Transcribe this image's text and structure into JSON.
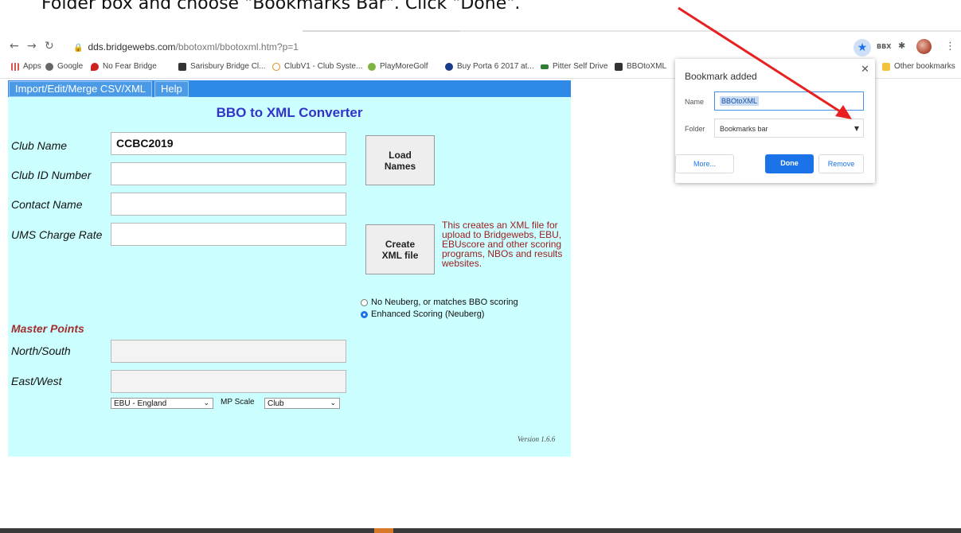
{
  "caption": "Folder box and choose \"Bookmarks Bar\". Click \"Done\".",
  "browser": {
    "url_host": "dds.bridgewebs.com",
    "url_path": "/bbotoxml/bbotoxml.htm?p=1",
    "extension_label": "BBX",
    "bookmarks": [
      {
        "label": "Apps",
        "color": "#d9534f"
      },
      {
        "label": "Google",
        "color": "#555555"
      },
      {
        "label": "No Fear Bridge",
        "color": "#cc2222"
      },
      {
        "label": "Sarisbury Bridge Cl...",
        "color": "#333333"
      },
      {
        "label": "ClubV1 - Club Syste...",
        "color": "#e88a1a"
      },
      {
        "label": "PlayMoreGolf",
        "color": "#7cb342"
      },
      {
        "label": "Buy Porta 6 2017 at...",
        "color": "#1a3a8a"
      },
      {
        "label": "Pitter Self Drive",
        "color": "#2e7d32"
      },
      {
        "label": "BBOtoXML",
        "color": "#333333"
      }
    ],
    "other_bookmarks": "Other bookmarks"
  },
  "app": {
    "menu": [
      "Import/Edit/Merge CSV/XML",
      "Help"
    ],
    "title": "BBO to XML Converter",
    "fields": {
      "club_name": {
        "label": "Club Name",
        "value": "CCBC2019"
      },
      "club_id": {
        "label": "Club ID Number",
        "value": ""
      },
      "contact_name": {
        "label": "Contact Name",
        "value": ""
      },
      "ums_charge": {
        "label": "UMS Charge Rate",
        "value": ""
      }
    },
    "load_names": "Load Names",
    "create_xml": "Create XML file",
    "create_note": "This creates an XML file for upload to Bridgewebs, EBU, EBUscore and other scoring programs, NBOs and results websites.",
    "scoring_options": [
      {
        "label": "No Neuberg, or matches BBO scoring",
        "selected": false
      },
      {
        "label": "Enhanced Scoring (Neuberg)",
        "selected": true
      }
    ],
    "master_points": {
      "heading": "Master Points",
      "north_south": "North/South",
      "east_west": "East/West",
      "ns_value": "",
      "ew_value": "",
      "region_select": "EBU - England",
      "mp_scale_label": "MP Scale",
      "mp_scale_value": "Club"
    },
    "version": "Version 1.6.6"
  },
  "popup": {
    "title": "Bookmark added",
    "name_label": "Name",
    "name_value": "BBOtoXML",
    "folder_label": "Folder",
    "folder_value": "Bookmarks bar",
    "more": "More...",
    "done": "Done",
    "remove": "Remove"
  },
  "colors": {
    "app_bg": "#ccffff",
    "menu_bar": "#2e8ae6",
    "title": "#3333cc",
    "note": "#9b1b1b",
    "accent_blue": "#1a73e8",
    "annotation_arrow": "#e8201f"
  }
}
